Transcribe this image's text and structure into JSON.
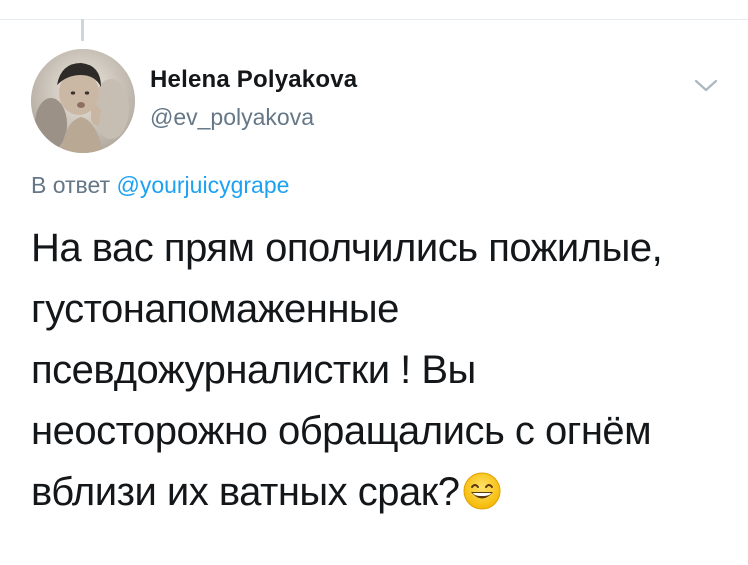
{
  "tweet": {
    "author": {
      "name": "Helena Polyakova",
      "handle": "@ev_polyakova"
    },
    "reply": {
      "prefix": "В ответ",
      "mention": "@yourjuicygrape"
    },
    "text_lines": [
      "На вас прям ополчились пожилые,",
      "густонапомаженные",
      "псевдожурналистки ! Вы",
      "неосторожно обращались с огнём",
      "вблизи их ватных срак?"
    ],
    "emoji": "grinning-face-with-smiling-eyes"
  },
  "colors": {
    "text": "#14171a",
    "secondary": "#657786",
    "link": "#1da1f2",
    "divider": "#e6ecf0"
  },
  "icons": {
    "more": "chevron-down-icon"
  }
}
